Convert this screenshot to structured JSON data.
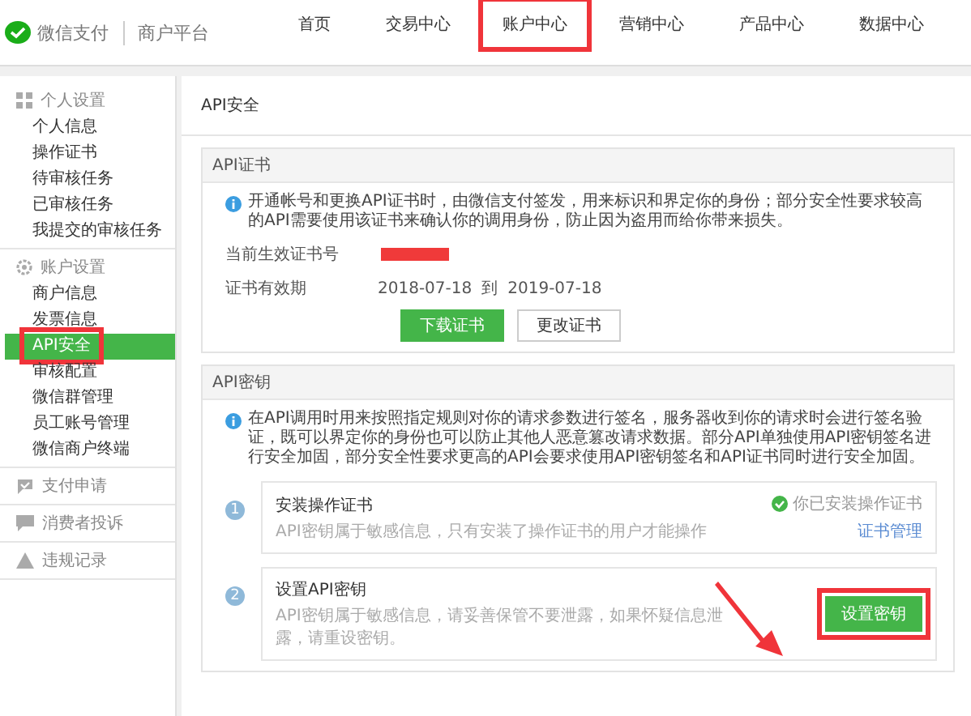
{
  "header": {
    "brand": "微信支付",
    "platform": "商户平台",
    "nav": [
      {
        "label": "首页",
        "marked": false
      },
      {
        "label": "交易中心",
        "marked": false
      },
      {
        "label": "账户中心",
        "marked": true
      },
      {
        "label": "营销中心",
        "marked": false
      },
      {
        "label": "产品中心",
        "marked": false
      },
      {
        "label": "数据中心",
        "marked": false
      }
    ]
  },
  "sidebar": {
    "groups": [
      {
        "title": "个人设置",
        "items": [
          {
            "label": "个人信息",
            "selected": false,
            "marked": false
          },
          {
            "label": "操作证书",
            "selected": false,
            "marked": false
          },
          {
            "label": "待审核任务",
            "selected": false,
            "marked": false
          },
          {
            "label": "已审核任务",
            "selected": false,
            "marked": false
          },
          {
            "label": "我提交的审核任务",
            "selected": false,
            "marked": false
          }
        ]
      },
      {
        "title": "账户设置",
        "items": [
          {
            "label": "商户信息",
            "selected": false,
            "marked": false
          },
          {
            "label": "发票信息",
            "selected": false,
            "marked": false
          },
          {
            "label": "API安全",
            "selected": true,
            "marked": true
          },
          {
            "label": "审核配置",
            "selected": false,
            "marked": false
          },
          {
            "label": "微信群管理",
            "selected": false,
            "marked": false
          },
          {
            "label": "员工账号管理",
            "selected": false,
            "marked": false
          },
          {
            "label": "微信商户终端",
            "selected": false,
            "marked": false
          }
        ]
      },
      {
        "title": "支付申请"
      },
      {
        "title": "消费者投诉"
      },
      {
        "title": "违规记录"
      }
    ]
  },
  "page": {
    "title": "API安全",
    "certificate": {
      "title": "API证书",
      "notice": "开通帐号和更换API证书时，由微信支付签发，用来标识和界定你的身份；部分安全性要求较高的API需要使用该证书来确认你的调用身份，防止因为盗用而给你带来损失。",
      "fields": [
        {
          "kind": "redacted",
          "label": "当前生效证书号"
        },
        {
          "kind": "range",
          "label": "证书有效期",
          "from": "2018-07-18",
          "sep": "到",
          "to": "2019-07-18"
        }
      ],
      "buttons": [
        {
          "kind": "primary",
          "label": "下载证书"
        },
        {
          "kind": "default",
          "label": "更改证书"
        }
      ]
    },
    "key": {
      "title": "API密钥",
      "notice": "在API调用时用来按照指定规则对你的请求参数进行签名，服务器收到你的请求时会进行签名验证，既可以界定你的身份也可以防止其他人恶意篡改请求数据。部分API单独使用API密钥签名进行安全加固，部分安全性要求更高的API会要求使用API密钥签名和API证书同时进行安全加固。",
      "steps": [
        {
          "number": "1",
          "title": "安装操作证书",
          "desc": "API密钥属于敏感信息，只有安装了操作证书的用户才能操作",
          "status": "你已安装操作证书",
          "link": "证书管理"
        },
        {
          "number": "2",
          "title": "设置API密钥",
          "desc": "API密钥属于敏感信息，请妥善保管不要泄露，如果怀疑信息泄露，请重设密钥。",
          "button": {
            "label": "设置密钥",
            "marked": true
          }
        }
      ]
    }
  }
}
